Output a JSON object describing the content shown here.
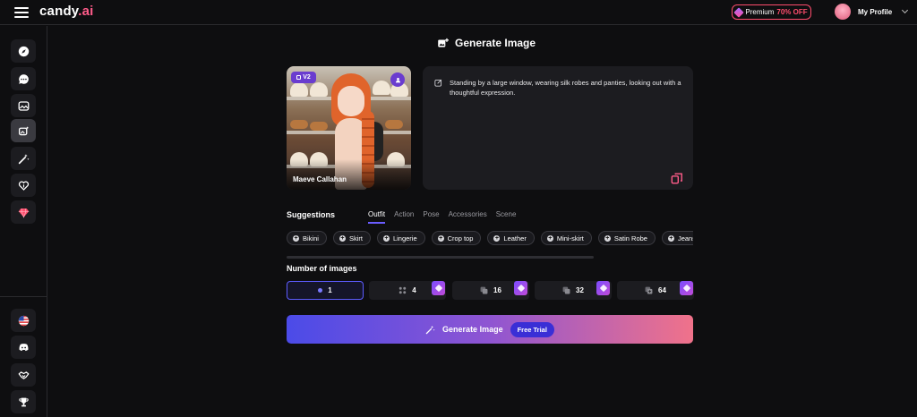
{
  "header": {
    "logo_main": "candy",
    "logo_accent": ".ai",
    "premium_label": "Premium",
    "premium_discount": "70% OFF",
    "profile_label": "My Profile"
  },
  "sidebar": {
    "items": [
      {
        "name": "explore",
        "icon": "compass-icon"
      },
      {
        "name": "chat",
        "icon": "chat-bubble-icon"
      },
      {
        "name": "gallery",
        "icon": "image-icon"
      },
      {
        "name": "generate-image",
        "icon": "image-generate-icon",
        "active": true
      },
      {
        "name": "create-character",
        "icon": "magic-wand-icon"
      },
      {
        "name": "my-ai",
        "icon": "heart-hands-icon"
      },
      {
        "name": "premium",
        "icon": "diamond-icon"
      }
    ],
    "bottom_items": [
      {
        "name": "language",
        "icon": "us-flag-icon"
      },
      {
        "name": "discord",
        "icon": "discord-icon"
      },
      {
        "name": "affiliate",
        "icon": "handshake-icon"
      },
      {
        "name": "leaderboard",
        "icon": "trophy-icon"
      }
    ]
  },
  "page": {
    "title": "Generate Image"
  },
  "character": {
    "badge": "V2",
    "name": "Maeve Callahan"
  },
  "prompt": {
    "text": "Standing by a large window, wearing silk robes and panties, looking out with a thoughtful expression."
  },
  "suggestions": {
    "label": "Suggestions",
    "tabs": [
      "Outfit",
      "Action",
      "Pose",
      "Accessories",
      "Scene"
    ],
    "active_tab": "Outfit",
    "chips": [
      "Bikini",
      "Skirt",
      "Lingerie",
      "Crop top",
      "Leather",
      "Mini-skirt",
      "Satin Robe",
      "Jeans"
    ]
  },
  "images": {
    "label": "Number of images",
    "options": [
      {
        "value": "1",
        "selected": true,
        "locked": false
      },
      {
        "value": "4",
        "selected": false,
        "locked": true
      },
      {
        "value": "16",
        "selected": false,
        "locked": true
      },
      {
        "value": "32",
        "selected": false,
        "locked": true
      },
      {
        "value": "64",
        "selected": false,
        "locked": true
      }
    ]
  },
  "generate": {
    "label": "Generate Image",
    "badge": "Free Trial"
  },
  "colors": {
    "accent_pink": "#ff5c8a",
    "accent_purple": "#6a3ccf",
    "selection_blue": "#5d5cff",
    "gradient_start": "#4b4be8",
    "gradient_end": "#f0728a"
  }
}
